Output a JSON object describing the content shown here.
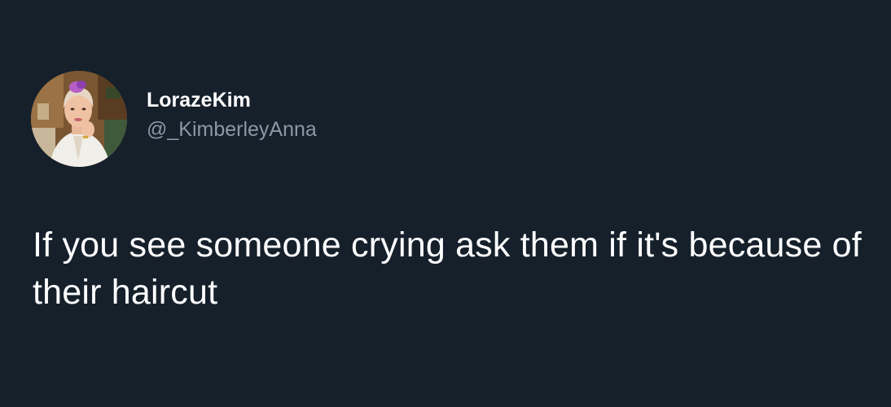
{
  "theme": {
    "background": "#15202b",
    "primary_text": "#ffffff",
    "secondary_text": "#8b98a5"
  },
  "author": {
    "display_name": "LorazeKim",
    "handle": "@_KimberleyAnna",
    "avatar_icon": "profile-photo"
  },
  "tweet": {
    "text": "If you see someone crying ask them if it's because of their haircut"
  }
}
